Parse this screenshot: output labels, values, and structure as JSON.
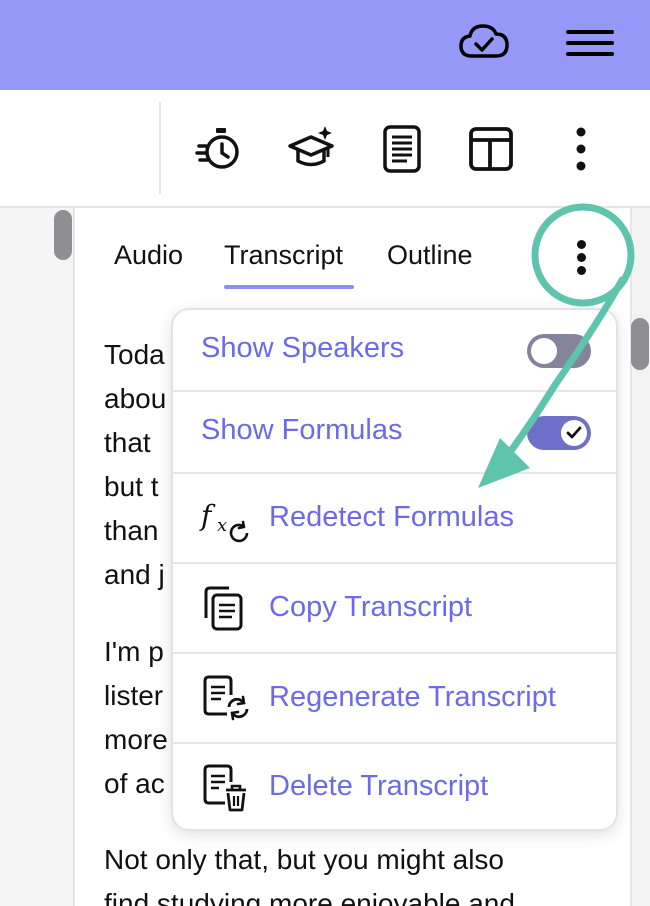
{
  "header": {
    "cloud_icon": "cloud-check-icon",
    "menu_icon": "hamburger-icon",
    "bar_color": "#9598F6"
  },
  "toolbar": {
    "icons": [
      "timer-icon",
      "graduation-cap-sparkle-icon",
      "document-icon",
      "layout-icon",
      "more-vertical-icon"
    ]
  },
  "tabs": {
    "items": [
      "Audio",
      "Transcript",
      "Outline"
    ],
    "active": "Transcript",
    "underline_color": "#8E8EF4"
  },
  "transcript": {
    "para1_lines": [
      "Toda",
      "abou",
      "that",
      "but t",
      "than",
      "and j"
    ],
    "para2_lines": [
      "I'm p",
      "lister",
      "more",
      "of ac"
    ],
    "para3_lines": [
      "Not only that, but you might also",
      "find studying more enjoyable and"
    ]
  },
  "menu": {
    "accent_color": "#6B6BEA",
    "items": [
      {
        "label": "Show Speakers",
        "toggle": "off"
      },
      {
        "label": "Show Formulas",
        "toggle": "on"
      },
      {
        "label": "Redetect Formulas",
        "icon": "formula-refresh-icon"
      },
      {
        "label": "Copy Transcript",
        "icon": "copy-document-icon"
      },
      {
        "label": "Regenerate Transcript",
        "icon": "document-refresh-icon"
      },
      {
        "label": "Delete Transcript",
        "icon": "document-trash-icon"
      }
    ]
  },
  "annotation": {
    "color": "#5EC4AE"
  }
}
